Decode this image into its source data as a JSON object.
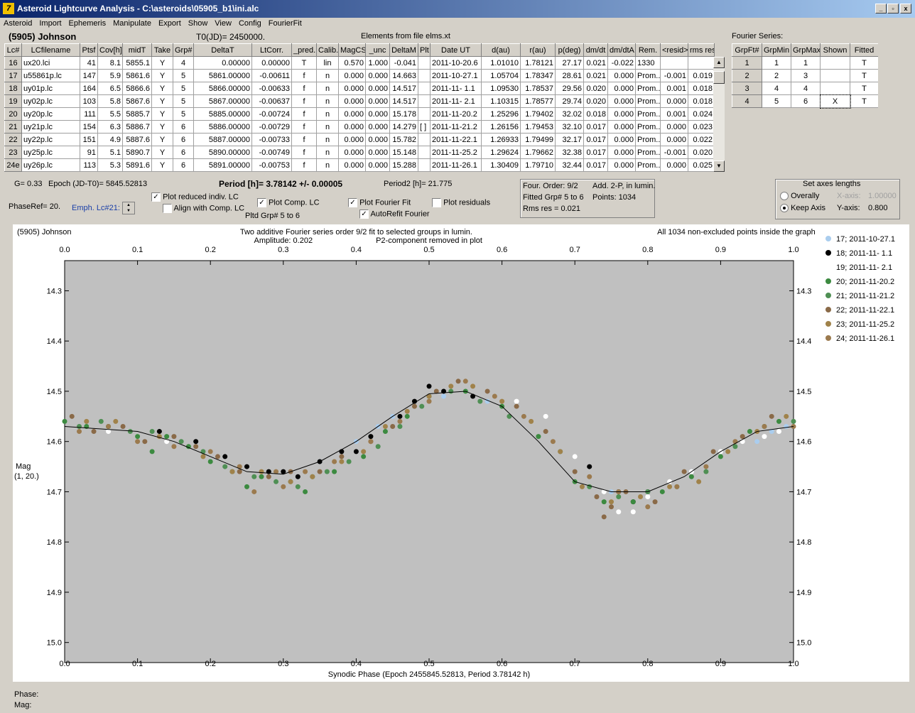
{
  "window": {
    "title": "Asteroid Lightcurve Analysis - C:\\asteroids\\05905_b1\\ini.alc",
    "app_icon": "7"
  },
  "menu": [
    "Asteroid",
    "Import",
    "Ephemeris",
    "Manipulate",
    "Export",
    "Show",
    "View",
    "Config",
    "FourierFit"
  ],
  "header": {
    "asteroid": "(5905) Johnson",
    "t0": "T0(JD)= 2450000.",
    "elements": "Elements from file elms.xt"
  },
  "lc_table": {
    "columns": [
      "Lc#",
      "LCfilename",
      "Ptsf",
      "Cov[h]",
      "midT",
      "Take",
      "Grp#",
      "DeltaT",
      "LtCorr.",
      "_pred.",
      "Calib.",
      "MagCS",
      "_unc",
      "DeltaM",
      "Plt",
      "Date UT",
      "d(au)",
      "r(au)",
      "p(deg)",
      "dm/dt",
      "dm/dtA",
      "Rem.",
      "<resid>",
      "rms res"
    ],
    "rows": [
      [
        "16",
        "ux20.lci",
        "41",
        "8.1",
        "5855.1",
        "Y",
        "4",
        "0.00000",
        "0.00000",
        "T",
        "lin",
        "0.570",
        "1.000",
        "-0.041",
        "",
        "2011-10-20.6",
        "1.01010",
        "1.78121",
        "27.17",
        "0.021",
        "-0.022",
        "1330",
        "",
        ""
      ],
      [
        "17",
        "u55861p.lc",
        "147",
        "5.9",
        "5861.6",
        "Y",
        "5",
        "5861.00000",
        "-0.00611",
        "f",
        "n",
        "0.000",
        "0.000",
        "14.663",
        "",
        "2011-10-27.1",
        "1.05704",
        "1.78347",
        "28.61",
        "0.021",
        "0.000",
        "Prom...",
        "-0.001",
        "0.019"
      ],
      [
        "18",
        "uy01p.lc",
        "164",
        "6.5",
        "5866.6",
        "Y",
        "5",
        "5866.00000",
        "-0.00633",
        "f",
        "n",
        "0.000",
        "0.000",
        "14.517",
        "",
        "2011-11- 1.1",
        "1.09530",
        "1.78537",
        "29.56",
        "0.020",
        "0.000",
        "Prom...",
        "0.001",
        "0.018"
      ],
      [
        "19",
        "uy02p.lc",
        "103",
        "5.8",
        "5867.6",
        "Y",
        "5",
        "5867.00000",
        "-0.00637",
        "f",
        "n",
        "0.000",
        "0.000",
        "14.517",
        "",
        "2011-11- 2.1",
        "1.10315",
        "1.78577",
        "29.74",
        "0.020",
        "0.000",
        "Prom...",
        "0.000",
        "0.018"
      ],
      [
        "20",
        "uy20p.lc",
        "111",
        "5.5",
        "5885.7",
        "Y",
        "5",
        "5885.00000",
        "-0.00724",
        "f",
        "n",
        "0.000",
        "0.000",
        "15.178",
        "",
        "2011-11-20.2",
        "1.25296",
        "1.79402",
        "32.02",
        "0.018",
        "0.000",
        "Prom...",
        "0.001",
        "0.024"
      ],
      [
        "21",
        "uy21p.lc",
        "154",
        "6.3",
        "5886.7",
        "Y",
        "6",
        "5886.00000",
        "-0.00729",
        "f",
        "n",
        "0.000",
        "0.000",
        "14.279",
        "[ ]",
        "2011-11-21.2",
        "1.26156",
        "1.79453",
        "32.10",
        "0.017",
        "0.000",
        "Prom...",
        "0.000",
        "0.023"
      ],
      [
        "22",
        "uy22p.lc",
        "151",
        "4.9",
        "5887.6",
        "Y",
        "6",
        "5887.00000",
        "-0.00733",
        "f",
        "n",
        "0.000",
        "0.000",
        "15.782",
        "",
        "2011-11-22.1",
        "1.26933",
        "1.79499",
        "32.17",
        "0.017",
        "0.000",
        "Prom...",
        "0.000",
        "0.022"
      ],
      [
        "23",
        "uy25p.lc",
        "91",
        "5.1",
        "5890.7",
        "Y",
        "6",
        "5890.00000",
        "-0.00749",
        "f",
        "n",
        "0.000",
        "0.000",
        "15.148",
        "",
        "2011-11-25.2",
        "1.29624",
        "1.79662",
        "32.38",
        "0.017",
        "0.000",
        "Prom...",
        "-0.001",
        "0.020"
      ],
      [
        "24e",
        "uy26p.lc",
        "113",
        "5.3",
        "5891.6",
        "Y",
        "6",
        "5891.00000",
        "-0.00753",
        "f",
        "n",
        "0.000",
        "0.000",
        "15.288",
        "",
        "2011-11-26.1",
        "1.30409",
        "1.79710",
        "32.44",
        "0.017",
        "0.000",
        "Prom...",
        "0.000",
        "0.025"
      ]
    ]
  },
  "fourier_series": {
    "label": "Fourier Series:",
    "columns": [
      "GrpFt#",
      "GrpMin",
      "GrpMax",
      "Shown",
      "Fitted"
    ],
    "rows": [
      [
        "1",
        "1",
        "1",
        "",
        "T"
      ],
      [
        "2",
        "2",
        "3",
        "",
        "T"
      ],
      [
        "3",
        "4",
        "4",
        "",
        "T"
      ],
      [
        "4",
        "5",
        "6",
        "X",
        "T"
      ]
    ]
  },
  "info": {
    "g": "G= 0.33",
    "epoch": "Epoch (JD-T0)= 5845.52813",
    "period": "Period [h]= 3.78142 +/- 0.00005",
    "period2": "Period2 [h]= 21.775",
    "phaseref": "PhaseRef= 20.",
    "emph": "Emph. Lc#21:",
    "pltd_grp": "Pltd Grp#  5  to  6"
  },
  "checkboxes": {
    "plot_reduced": {
      "label": "Plot reduced indiv. LC",
      "checked": true
    },
    "align_comp": {
      "label": "Align with Comp. LC",
      "checked": false
    },
    "plot_comp": {
      "label": "Plot Comp. LC",
      "checked": true
    },
    "plot_fourier": {
      "label": "Plot Fourier Fit",
      "checked": true
    },
    "plot_residuals": {
      "label": "Plot residuals",
      "checked": false
    },
    "autorefit": {
      "label": "AutoRefit Fourier",
      "checked": true
    }
  },
  "fit_summary": {
    "order": "Four. Order:  9/2",
    "add": "Add. 2-P, in lumin.",
    "fitted": "Fitted Grp# 5 to 6",
    "points": "Points: 1034",
    "rms": "Rms res     = 0.021"
  },
  "axes_box": {
    "title": "Set axes lengths",
    "overally": "Overally",
    "keep": "Keep Axis",
    "xaxis_label": "X-axis:",
    "xaxis_value": "1.00000",
    "yaxis_label": "Y-axis:",
    "yaxis_value": "0.800"
  },
  "status": {
    "phase": "Phase:",
    "mag": "Mag:"
  },
  "chart_data": {
    "type": "scatter",
    "title_left": "(5905) Johnson",
    "title_center": "Two additive Fourier series order 9/2 fit to selected groups in lumin.",
    "subtitle_amp": "Amplitude: 0.202",
    "subtitle_p2": "P2-component removed in plot",
    "title_right": "All 1034 non-excluded points inside the graph",
    "xlabel": "Synodic Phase (Epoch 2455845.52813, Period 3.78142 h)",
    "ylabel": "Mag",
    "ylabel2": "(1, 20.)",
    "xlim": [
      0.0,
      1.0
    ],
    "ylim": [
      14.24,
      15.04
    ],
    "y_inverted": true,
    "xticks": [
      "0.0",
      "0.1",
      "0.2",
      "0.3",
      "0.4",
      "0.5",
      "0.6",
      "0.7",
      "0.8",
      "0.9",
      "1.0"
    ],
    "yticks": [
      "14.3",
      "14.4",
      "14.5",
      "14.6",
      "14.7",
      "14.8",
      "14.9",
      "15.0"
    ],
    "ytick_values": [
      14.3,
      14.4,
      14.5,
      14.6,
      14.7,
      14.8,
      14.9,
      15.0
    ],
    "fit_curve": {
      "x": [
        0.0,
        0.05,
        0.1,
        0.15,
        0.2,
        0.25,
        0.3,
        0.35,
        0.4,
        0.45,
        0.5,
        0.55,
        0.6,
        0.65,
        0.7,
        0.75,
        0.8,
        0.85,
        0.9,
        0.95,
        1.0
      ],
      "y": [
        14.57,
        14.575,
        14.58,
        14.6,
        14.63,
        14.66,
        14.665,
        14.64,
        14.6,
        14.55,
        14.505,
        14.5,
        14.53,
        14.6,
        14.68,
        14.7,
        14.7,
        14.67,
        14.62,
        14.58,
        14.57
      ]
    },
    "series": [
      {
        "name": "17; 2011-10-27.1",
        "color": "#aacdee",
        "x": [
          0.52,
          0.58,
          0.63,
          0.7,
          0.75,
          0.8,
          0.83,
          0.86,
          0.9,
          0.95,
          0.97,
          0.99,
          0.35,
          0.4,
          0.43,
          0.45
        ],
        "y": [
          14.51,
          14.52,
          14.55,
          14.66,
          14.7,
          14.7,
          14.69,
          14.66,
          14.62,
          14.6,
          14.58,
          14.57,
          14.64,
          14.6,
          14.57,
          14.55
        ]
      },
      {
        "name": "18; 2011-11- 1.1",
        "color": "#000000",
        "x": [
          0.13,
          0.18,
          0.22,
          0.25,
          0.28,
          0.3,
          0.32,
          0.35,
          0.38,
          0.4,
          0.42,
          0.46,
          0.48,
          0.5,
          0.52,
          0.56,
          0.72,
          0.76,
          0.78,
          0.8
        ],
        "y": [
          14.58,
          14.6,
          14.63,
          14.65,
          14.66,
          14.66,
          14.67,
          14.64,
          14.62,
          14.62,
          14.59,
          14.55,
          14.52,
          14.49,
          14.5,
          14.51,
          14.65,
          14.7,
          14.72,
          14.7
        ]
      },
      {
        "name": "19; 2011-11- 2.1",
        "color": "#ffffff",
        "x": [
          0.06,
          0.1,
          0.14,
          0.2,
          0.62,
          0.66,
          0.7,
          0.74,
          0.76,
          0.78,
          0.8,
          0.83,
          0.86,
          0.9,
          0.93,
          0.96,
          0.98
        ],
        "y": [
          14.58,
          14.59,
          14.6,
          14.62,
          14.52,
          14.55,
          14.63,
          14.7,
          14.74,
          14.74,
          14.71,
          14.68,
          14.66,
          14.62,
          14.6,
          14.59,
          14.58
        ]
      },
      {
        "name": "20; 2011-11-20.2",
        "color": "#3c8a40",
        "x": [
          0.0,
          0.03,
          0.06,
          0.1,
          0.14,
          0.17,
          0.2,
          0.23,
          0.27,
          0.31,
          0.34,
          0.37,
          0.41,
          0.44,
          0.47,
          0.5,
          0.55,
          0.6,
          0.65,
          0.7,
          0.74,
          0.78,
          0.82,
          0.86,
          0.9,
          0.94,
          0.98,
          0.12,
          0.25,
          0.33
        ],
        "y": [
          14.56,
          14.57,
          14.57,
          14.59,
          14.59,
          14.61,
          14.64,
          14.66,
          14.67,
          14.68,
          14.67,
          14.66,
          14.63,
          14.58,
          14.55,
          14.51,
          14.5,
          14.53,
          14.59,
          14.68,
          14.72,
          14.72,
          14.7,
          14.67,
          14.63,
          14.58,
          14.56,
          14.62,
          14.69,
          14.7
        ]
      },
      {
        "name": "21; 2011-11-21.2",
        "color": "#4f8f54",
        "x": [
          0.02,
          0.05,
          0.09,
          0.12,
          0.16,
          0.19,
          0.22,
          0.26,
          0.29,
          0.32,
          0.36,
          0.39,
          0.43,
          0.46,
          0.49,
          0.53,
          0.57,
          0.61,
          0.68,
          0.72,
          0.76,
          0.8,
          0.84,
          0.88,
          0.92,
          0.96,
          1.0
        ],
        "y": [
          14.57,
          14.56,
          14.58,
          14.58,
          14.6,
          14.62,
          14.65,
          14.67,
          14.68,
          14.69,
          14.66,
          14.64,
          14.61,
          14.57,
          14.53,
          14.5,
          14.52,
          14.55,
          14.62,
          14.69,
          14.71,
          14.7,
          14.69,
          14.66,
          14.61,
          14.57,
          14.56
        ]
      },
      {
        "name": "22; 2011-11-22.1",
        "color": "#8a6a48",
        "x": [
          0.01,
          0.04,
          0.08,
          0.11,
          0.15,
          0.18,
          0.21,
          0.24,
          0.28,
          0.31,
          0.35,
          0.38,
          0.42,
          0.45,
          0.48,
          0.51,
          0.54,
          0.58,
          0.62,
          0.66,
          0.7,
          0.73,
          0.77,
          0.81,
          0.85,
          0.89,
          0.93,
          0.97,
          0.74,
          0.75
        ],
        "y": [
          14.55,
          14.58,
          14.57,
          14.6,
          14.59,
          14.61,
          14.63,
          14.66,
          14.67,
          14.66,
          14.66,
          14.63,
          14.6,
          14.57,
          14.53,
          14.5,
          14.48,
          14.5,
          14.53,
          14.58,
          14.66,
          14.71,
          14.7,
          14.72,
          14.66,
          14.62,
          14.59,
          14.55,
          14.75,
          14.73
        ]
      },
      {
        "name": "23; 2011-11-25.2",
        "color": "#a0824a",
        "x": [
          0.03,
          0.07,
          0.13,
          0.19,
          0.23,
          0.27,
          0.31,
          0.34,
          0.38,
          0.41,
          0.44,
          0.47,
          0.5,
          0.53,
          0.56,
          0.6,
          0.64,
          0.68,
          0.71,
          0.75,
          0.79,
          0.83,
          0.87,
          0.91,
          0.95,
          0.99
        ],
        "y": [
          14.56,
          14.56,
          14.59,
          14.63,
          14.66,
          14.66,
          14.68,
          14.67,
          14.64,
          14.62,
          14.57,
          14.54,
          14.51,
          14.49,
          14.49,
          14.52,
          14.56,
          14.62,
          14.69,
          14.72,
          14.71,
          14.69,
          14.68,
          14.62,
          14.58,
          14.55
        ]
      },
      {
        "name": "24; 2011-11-26.1",
        "color": "#9b7a4e",
        "x": [
          0.02,
          0.06,
          0.1,
          0.15,
          0.2,
          0.24,
          0.29,
          0.33,
          0.37,
          0.42,
          0.46,
          0.5,
          0.55,
          0.59,
          0.63,
          0.67,
          0.72,
          0.76,
          0.8,
          0.84,
          0.88,
          0.92,
          0.96,
          1.0,
          0.26,
          0.3
        ],
        "y": [
          14.58,
          14.57,
          14.6,
          14.61,
          14.62,
          14.65,
          14.66,
          14.66,
          14.64,
          14.6,
          14.56,
          14.52,
          14.48,
          14.51,
          14.55,
          14.6,
          14.67,
          14.7,
          14.73,
          14.69,
          14.65,
          14.6,
          14.57,
          14.57,
          14.7,
          14.69
        ]
      }
    ]
  }
}
